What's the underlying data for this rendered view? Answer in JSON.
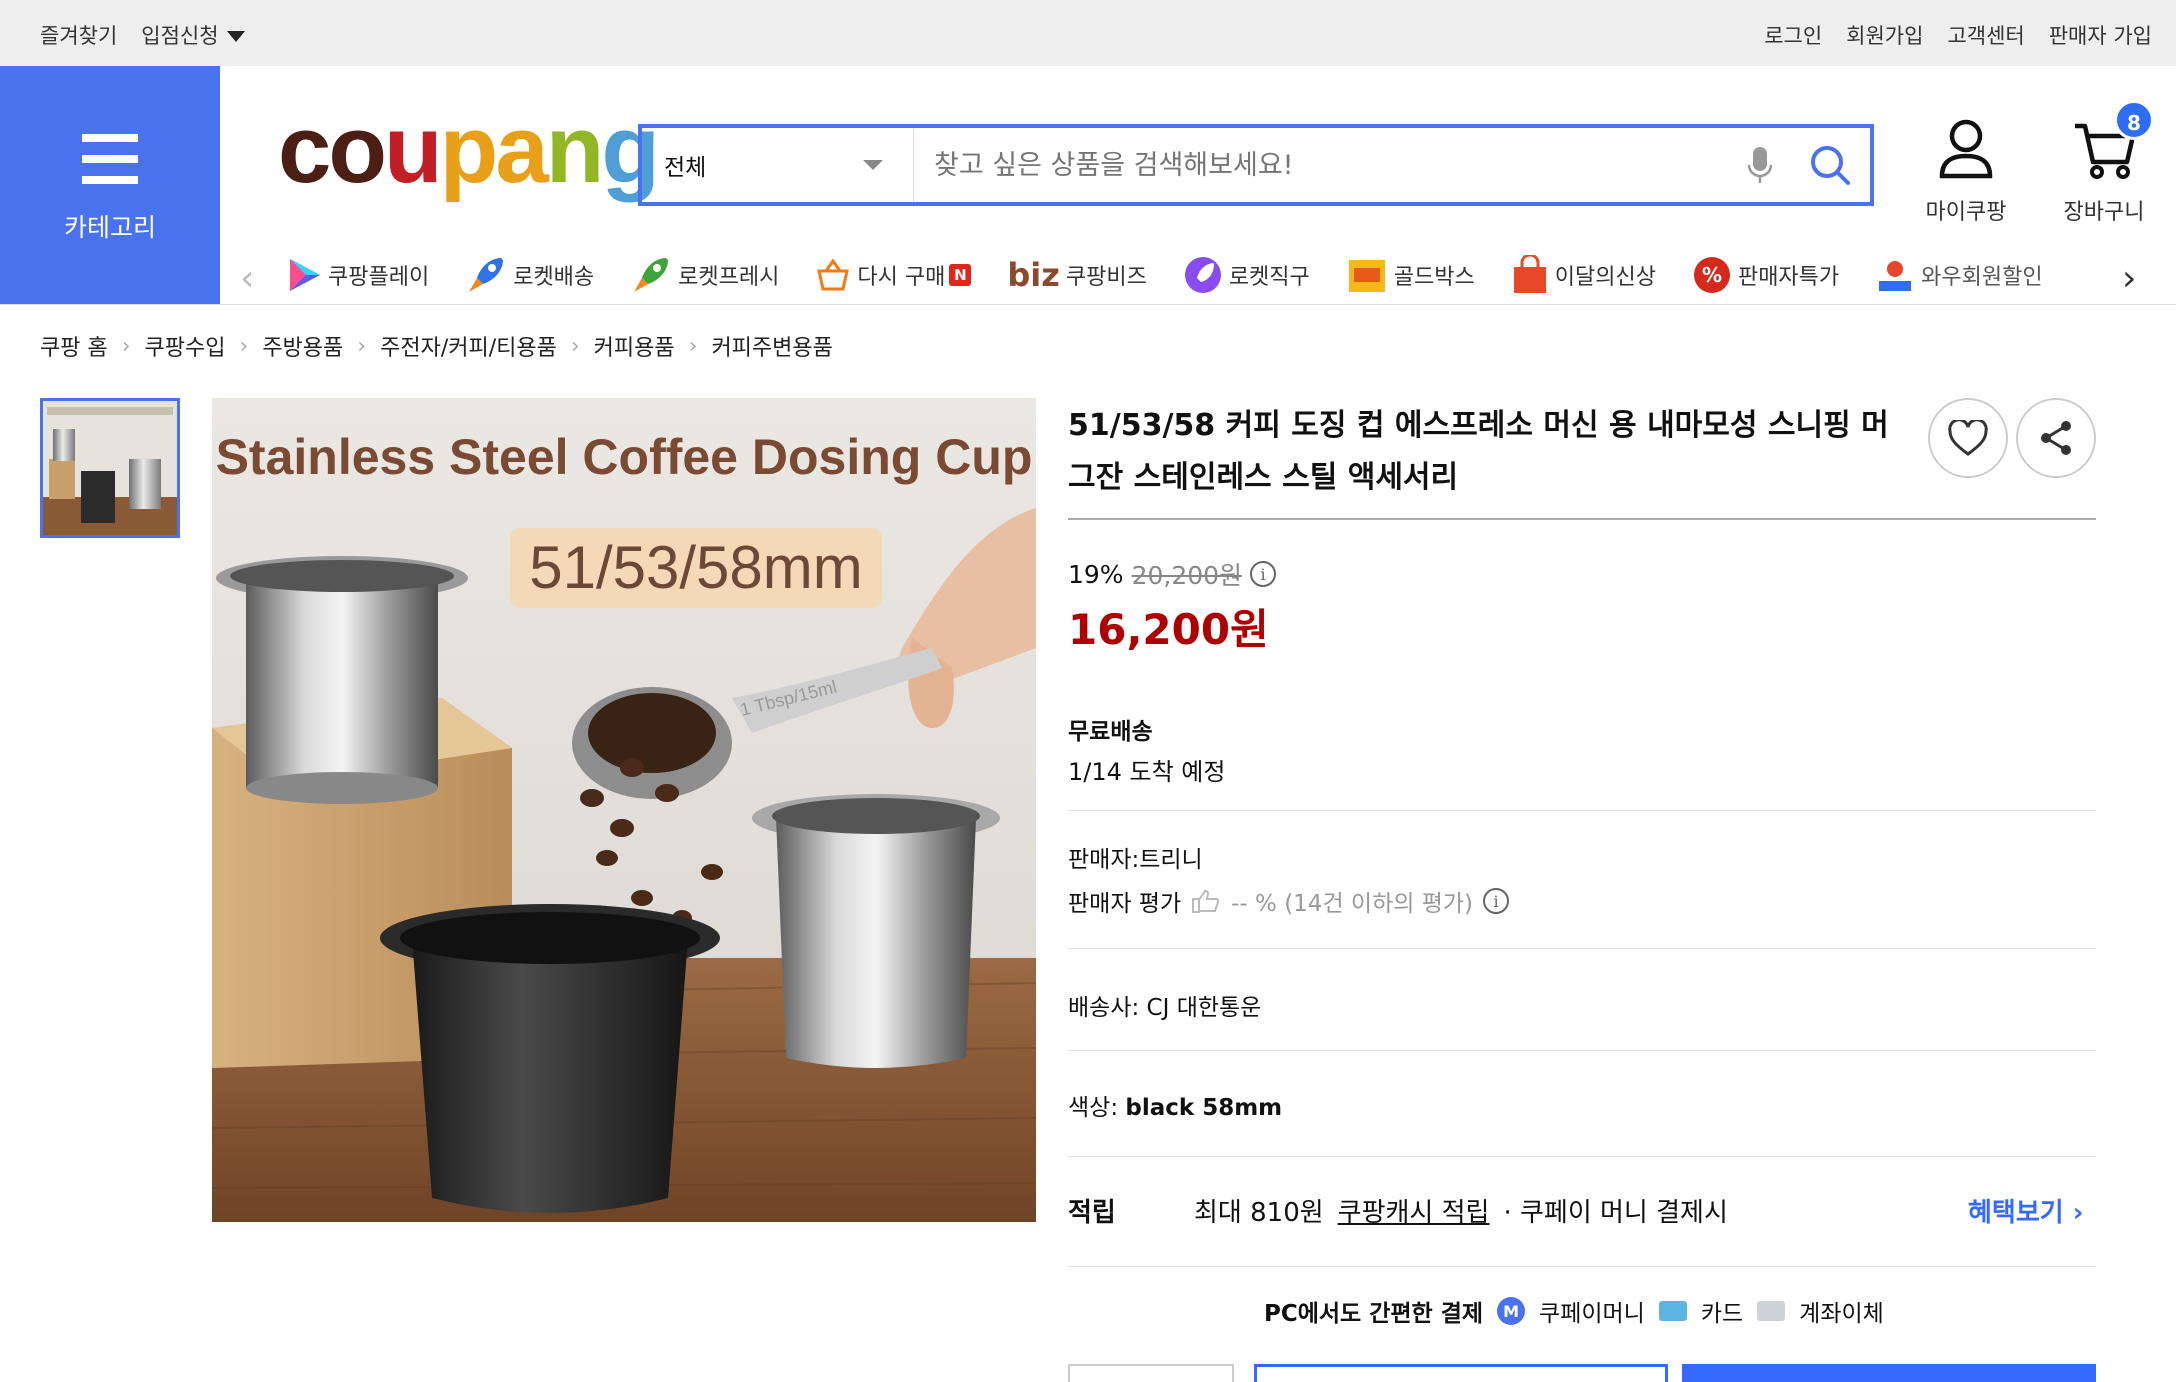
{
  "topbar": {
    "left": [
      "즐겨찾기",
      "입점신청"
    ],
    "right": [
      "로그인",
      "회원가입",
      "고객센터",
      "판매자 가입"
    ]
  },
  "header": {
    "category_label": "카테고리",
    "logo": [
      "c",
      "o",
      "u",
      "p",
      "a",
      "n",
      "g"
    ],
    "search": {
      "scope": "전체",
      "placeholder": "찾고 싶은 상품을 검색해보세요!"
    },
    "my_label": "마이쿠팡",
    "cart_label": "장바구니",
    "cart_count": "8"
  },
  "catnav": [
    "쿠팡플레이",
    "로켓배송",
    "로켓프레시",
    "다시 구매",
    "쿠팡비즈",
    "로켓직구",
    "골드박스",
    "이달의신상",
    "판매자특가",
    "와우회원할인"
  ],
  "catnav_extra": {
    "new_badge": "N",
    "biz_prefix": "biz"
  },
  "breadcrumb": [
    "쿠팡 홈",
    "쿠팡수입",
    "주방용품",
    "주전자/커피/티용품",
    "커피용품",
    "커피주변용품"
  ],
  "image": {
    "headline": "Stainless Steel Coffee Dosing Cup",
    "size_tag": "51/53/58mm",
    "spoon_text": "1 Tbsp/15ml"
  },
  "product": {
    "title": "51/53/58 커피 도징 컵 에스프레소 머신 용 내마모성 스니핑 머그잔 스테인레스 스틸 액세서리",
    "discount_rate": "19%",
    "original_price": "20,200원",
    "price": "16,200원",
    "shipping_title": "무료배송",
    "shipping_date": "1/14 도착 예정",
    "seller": "판매자:트리니",
    "seller_rating_label": "판매자 평가",
    "seller_rating_value": "-- % (14건 이하의 평가)",
    "carrier": "배송사:  CJ 대한통운",
    "color_label": "색상:",
    "color_value": "black 58mm",
    "reward_title": "적립",
    "reward_amount": "최대 810원",
    "reward_link": "쿠팡캐시 적립",
    "reward_tail": "· 쿠페이 머니 결제시",
    "benefit_link": "혜택보기 ›",
    "pay_lead": "PC에서도 간편한 결제",
    "pay_methods": [
      "쿠페이머니",
      "카드",
      "계좌이체"
    ],
    "pay_m_glyph": "M"
  },
  "colors": {
    "brand_blue": "#4a72ef",
    "price_red": "#ae0000",
    "link_blue": "#346aff"
  }
}
